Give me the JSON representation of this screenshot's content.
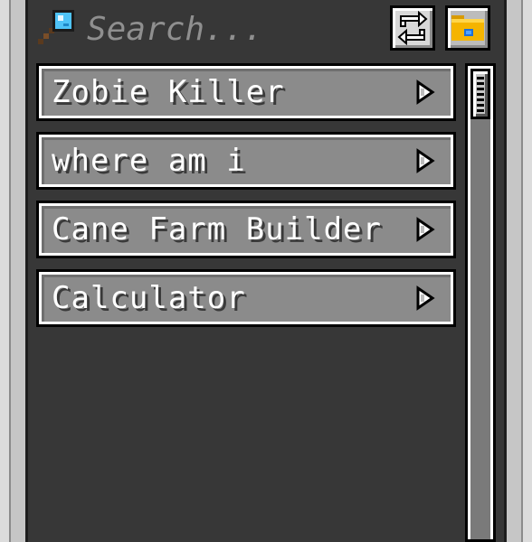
{
  "search": {
    "placeholder": "Search...",
    "icon": "magnifier-icon"
  },
  "toolbar": {
    "refresh_icon": "refresh-icon",
    "folder_icon": "folder-icon"
  },
  "scripts": [
    {
      "label": "Zobie Killer",
      "icon": "run-arrow-icon"
    },
    {
      "label": "where am i",
      "icon": "run-arrow-icon"
    },
    {
      "label": "Cane Farm Builder",
      "icon": "run-arrow-icon"
    },
    {
      "label": "Calculator",
      "icon": "run-arrow-icon"
    }
  ],
  "colors": {
    "panel_bg": "#373737",
    "item_bg": "#8b8b8b",
    "frame": "#c6c6c6",
    "lens": "#4fc3f7",
    "folder": "#f5b400"
  }
}
